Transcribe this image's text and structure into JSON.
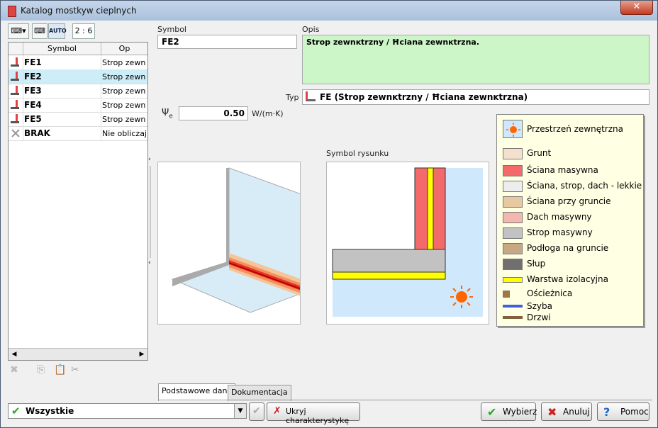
{
  "window": {
    "title": "Katalog mostkyw cieplnych",
    "close_label": "✕"
  },
  "toolbar": {
    "ratio": "2 : 6",
    "auto_label": "AUTO"
  },
  "grid": {
    "col_symbol": "Symbol",
    "col_desc": "Op",
    "rows": [
      {
        "symbol": "FE1",
        "desc": "Strop zewn"
      },
      {
        "symbol": "FE2",
        "desc": "Strop zewn"
      },
      {
        "symbol": "FE3",
        "desc": "Strop zewn"
      },
      {
        "symbol": "FE4",
        "desc": "Strop zewn"
      },
      {
        "symbol": "FE5",
        "desc": "Strop zewn"
      },
      {
        "symbol": "BRAK",
        "desc": "Nie obliczaj"
      }
    ],
    "selected_index": 1
  },
  "form": {
    "symbol_label": "Symbol",
    "symbol_value": "FE2",
    "opis_label": "Opis",
    "opis_value": "Strop zewnĸtrzny / Ħciana zewnĸtrzna.",
    "typ_label": "Typ",
    "typ_value": "FE (Strop zewnĸtrzny / Ħciana zewnĸtrzna)",
    "psi_label": "Ψ",
    "psi_sub": "e",
    "psi_value": "0.50",
    "psi_unit": "W/(m·K)",
    "symbol_rysunku_label": "Symbol rysunku"
  },
  "legend": [
    {
      "label": "Przestrzeń zewnętrzna",
      "color": "#cfe8fb"
    },
    {
      "label": "Grunt",
      "color": "#f3e1cd"
    },
    {
      "label": "Ściana masywna",
      "color": "#f36a6a"
    },
    {
      "label": "Ściana, strop, dach - lekkie",
      "color": "#ededed"
    },
    {
      "label": "Ściana przy gruncie",
      "color": "#e8c8a0"
    },
    {
      "label": "Dach masywny",
      "color": "#f2b8b0"
    },
    {
      "label": "Strop masywny",
      "color": "#c2c2c2"
    },
    {
      "label": "Podłoga na gruncie",
      "color": "#c8a882"
    },
    {
      "label": "Słup",
      "color": "#707070"
    },
    {
      "label": "Warstwa izolacyjna",
      "color": "#ffff00"
    },
    {
      "label": "Ościeżnica",
      "color": "#a07840"
    },
    {
      "label": "Szyba",
      "color": "#4060e0"
    },
    {
      "label": "Drzwi",
      "color": "#806040"
    }
  ],
  "tabs": [
    {
      "label": "Podstawowe dane"
    },
    {
      "label": "Dokumentacja"
    }
  ],
  "bottom": {
    "filter_value": "Wszystkie",
    "hide_label": "Ukryj charakterystykę",
    "choose_label": "Wybierz",
    "cancel_label": "Anuluj",
    "help_label": "Pomoc"
  }
}
